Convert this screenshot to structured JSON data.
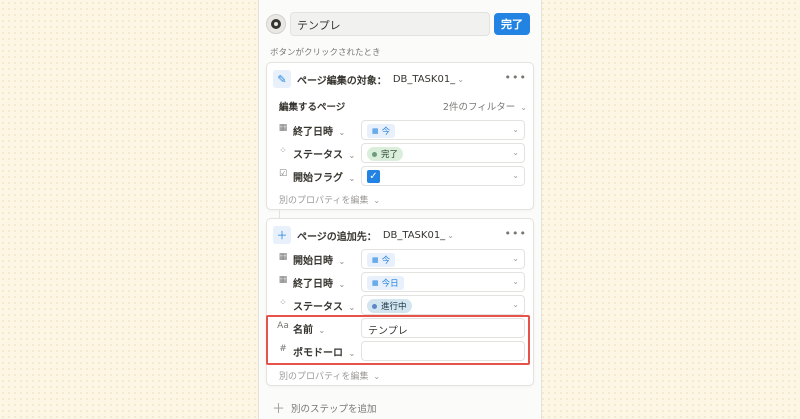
{
  "topbar": {
    "name_value": "テンプレ",
    "done_label": "完了",
    "avatar_icon": "gear-icon"
  },
  "trigger_label": "ボタンがクリックされたとき",
  "card1": {
    "icon": "edit-icon",
    "title": "ページ編集の対象：",
    "database": "DB_TASK01_",
    "target_label": "編集するページ",
    "filter_label": "2件のフィルター",
    "props": [
      {
        "icon": "calendar-icon",
        "name": "終了日時",
        "value": "今",
        "kind": "date"
      },
      {
        "icon": "status-icon",
        "name": "ステータス",
        "value": "完了",
        "kind": "status-done"
      },
      {
        "icon": "checkbox-icon",
        "name": "開始フラグ",
        "value": "",
        "kind": "checkbox"
      }
    ],
    "edit_other": "別のプロパティを編集"
  },
  "card2": {
    "icon": "plus-icon",
    "title": "ページの追加先：",
    "database": "DB_TASK01_",
    "props": [
      {
        "icon": "calendar-icon",
        "name": "開始日時",
        "value": "今",
        "kind": "date"
      },
      {
        "icon": "calendar-icon",
        "name": "終了日時",
        "value": "今日",
        "kind": "date"
      },
      {
        "icon": "status-icon",
        "name": "ステータス",
        "value": "進行中",
        "kind": "status-progress"
      },
      {
        "icon": "text-icon",
        "icon_text": "Aa",
        "name": "名前",
        "value": "テンプレ",
        "kind": "text"
      },
      {
        "icon": "number-icon",
        "icon_text": "#",
        "name": "ポモドーロ",
        "value": "",
        "kind": "text"
      }
    ],
    "edit_other": "別のプロパティを編集"
  },
  "add_step_label": "別のステップを追加",
  "colors": {
    "accent": "#2383e2",
    "highlight": "#e5534b"
  }
}
